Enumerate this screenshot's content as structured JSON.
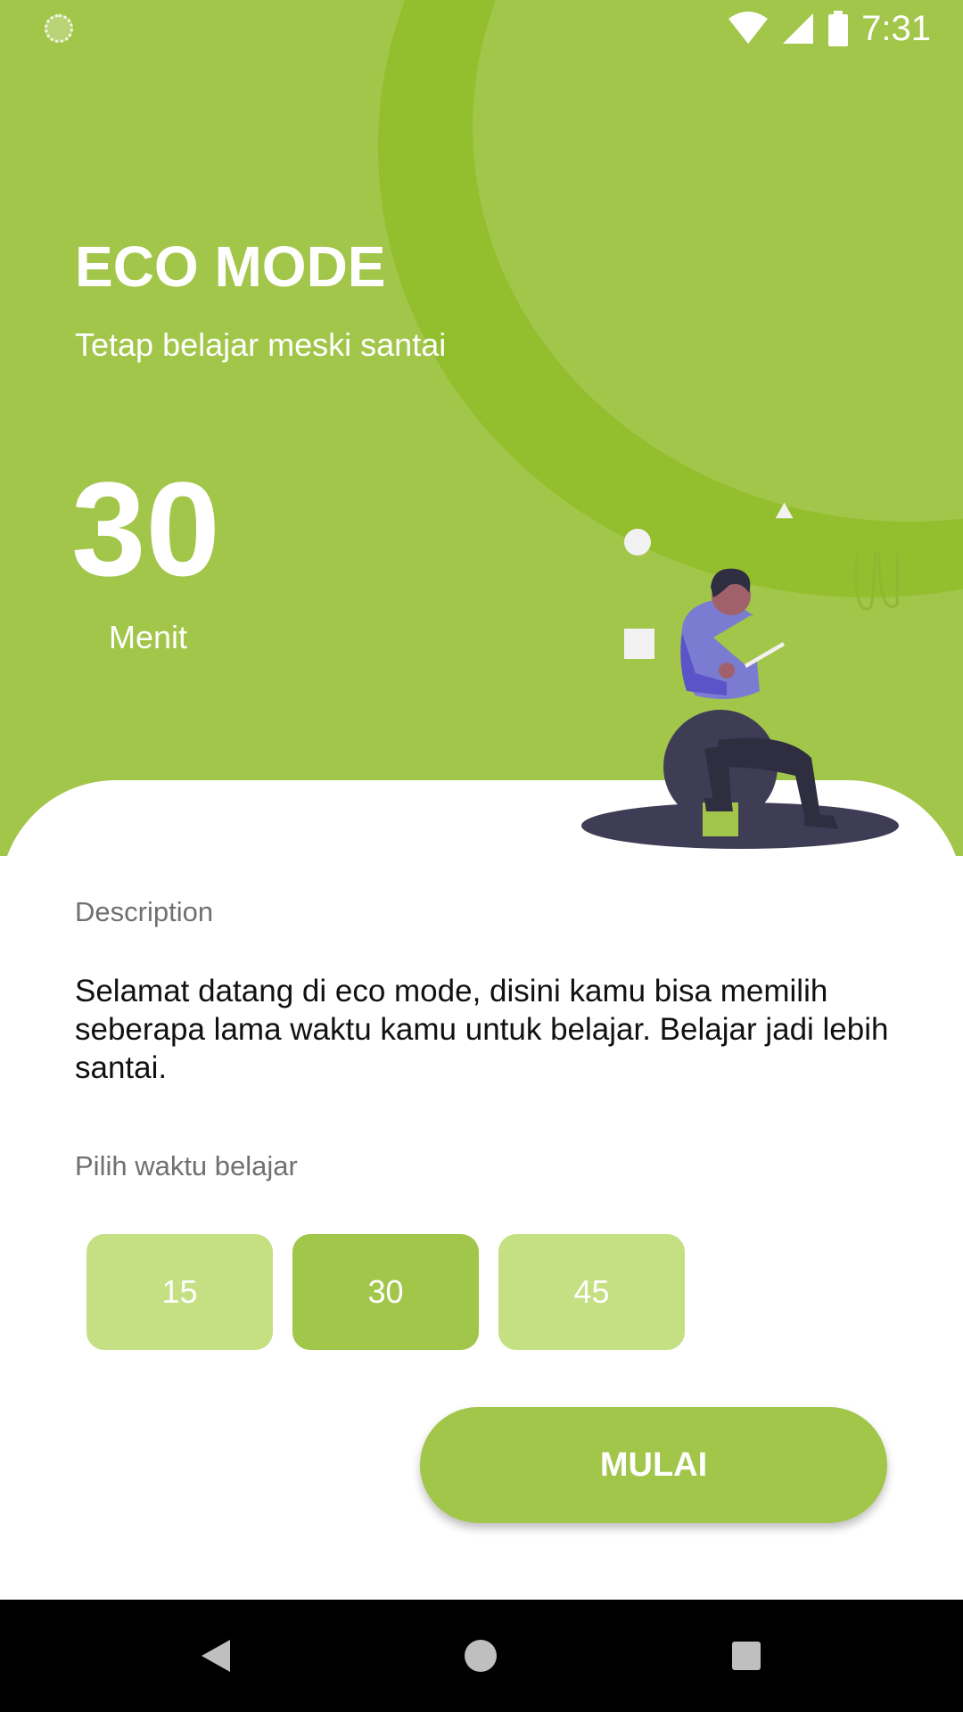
{
  "status_bar": {
    "time": "7:31"
  },
  "header": {
    "title": "ECO MODE",
    "subtitle": "Tetap belajar meski santai",
    "selected_minutes": "30",
    "unit_label": "Menit"
  },
  "content": {
    "description_label": "Description",
    "description_text": "Selamat datang di eco mode, disini kamu bisa memilih seberapa lama waktu kamu untuk belajar. Belajar jadi lebih santai.",
    "choose_label": "Pilih waktu belajar",
    "options": [
      {
        "label": "15",
        "selected": false
      },
      {
        "label": "30",
        "selected": true
      },
      {
        "label": "45",
        "selected": false
      }
    ],
    "start_label": "MULAI"
  },
  "colors": {
    "primary": "#A2C64A",
    "ring": "#93BE2D",
    "option_light": "#C5E083",
    "illustration_dark": "#3F3D56",
    "illustration_shirt": "#6C63FF"
  },
  "icons": {
    "status": [
      "app-notification-icon",
      "wifi-icon",
      "signal-icon",
      "battery-icon"
    ],
    "nav": [
      "back-icon",
      "home-icon",
      "recents-icon"
    ],
    "illustration": "person-reading-on-ball-illustration"
  }
}
